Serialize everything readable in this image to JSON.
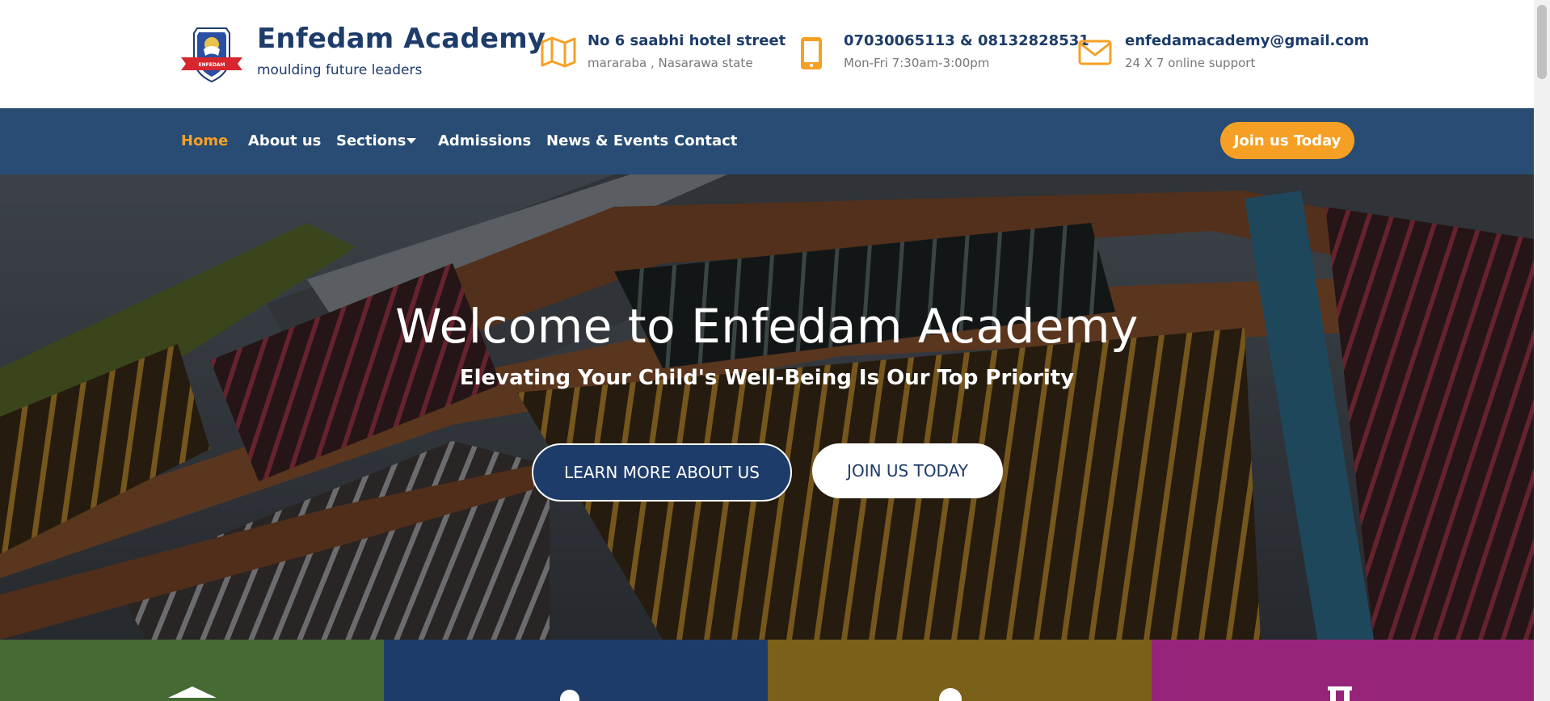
{
  "brand": {
    "name": "Enfedam Academy",
    "tagline": "moulding future leaders",
    "logo_icon": "school-crest-logo",
    "colors": {
      "navy": "#1d3c6a",
      "accent": "#f5a025",
      "nav_bg": "#284c74"
    }
  },
  "contact": {
    "address": {
      "icon": "map-icon",
      "line1": "No 6 saabhi hotel street",
      "line2": "mararaba , Nasarawa state"
    },
    "phone": {
      "icon": "mobile-phone-icon",
      "line1": "07030065113 & 08132828531",
      "line2": "Mon-Fri 7:30am-3:00pm"
    },
    "email": {
      "icon": "envelope-icon",
      "line1": "enfedamacademy@gmail.com",
      "line2": "24 X 7 online support"
    }
  },
  "nav": {
    "items": [
      {
        "label": "Home",
        "active": true
      },
      {
        "label": "About us"
      },
      {
        "label": "Sections",
        "dropdown": true
      },
      {
        "label": "Admissions"
      },
      {
        "label": "News & Events"
      },
      {
        "label": "Contact"
      }
    ],
    "cta": "Join us Today"
  },
  "hero": {
    "title": "Welcome to Enfedam Academy",
    "subtitle": "Elevating Your Child's Well-Being Is Our Top Priority",
    "primary_button": "LEARN MORE ABOUT US",
    "secondary_button": "JOIN US TODAY"
  },
  "tiles": [
    {
      "color": "#456a34",
      "icon": "graduation-cap-icon"
    },
    {
      "color": "#1d3c6a",
      "icon": "person-icon"
    },
    {
      "color": "#7a6019",
      "icon": "person-icon"
    },
    {
      "color": "#97247b",
      "icon": "pillar-icon"
    }
  ]
}
